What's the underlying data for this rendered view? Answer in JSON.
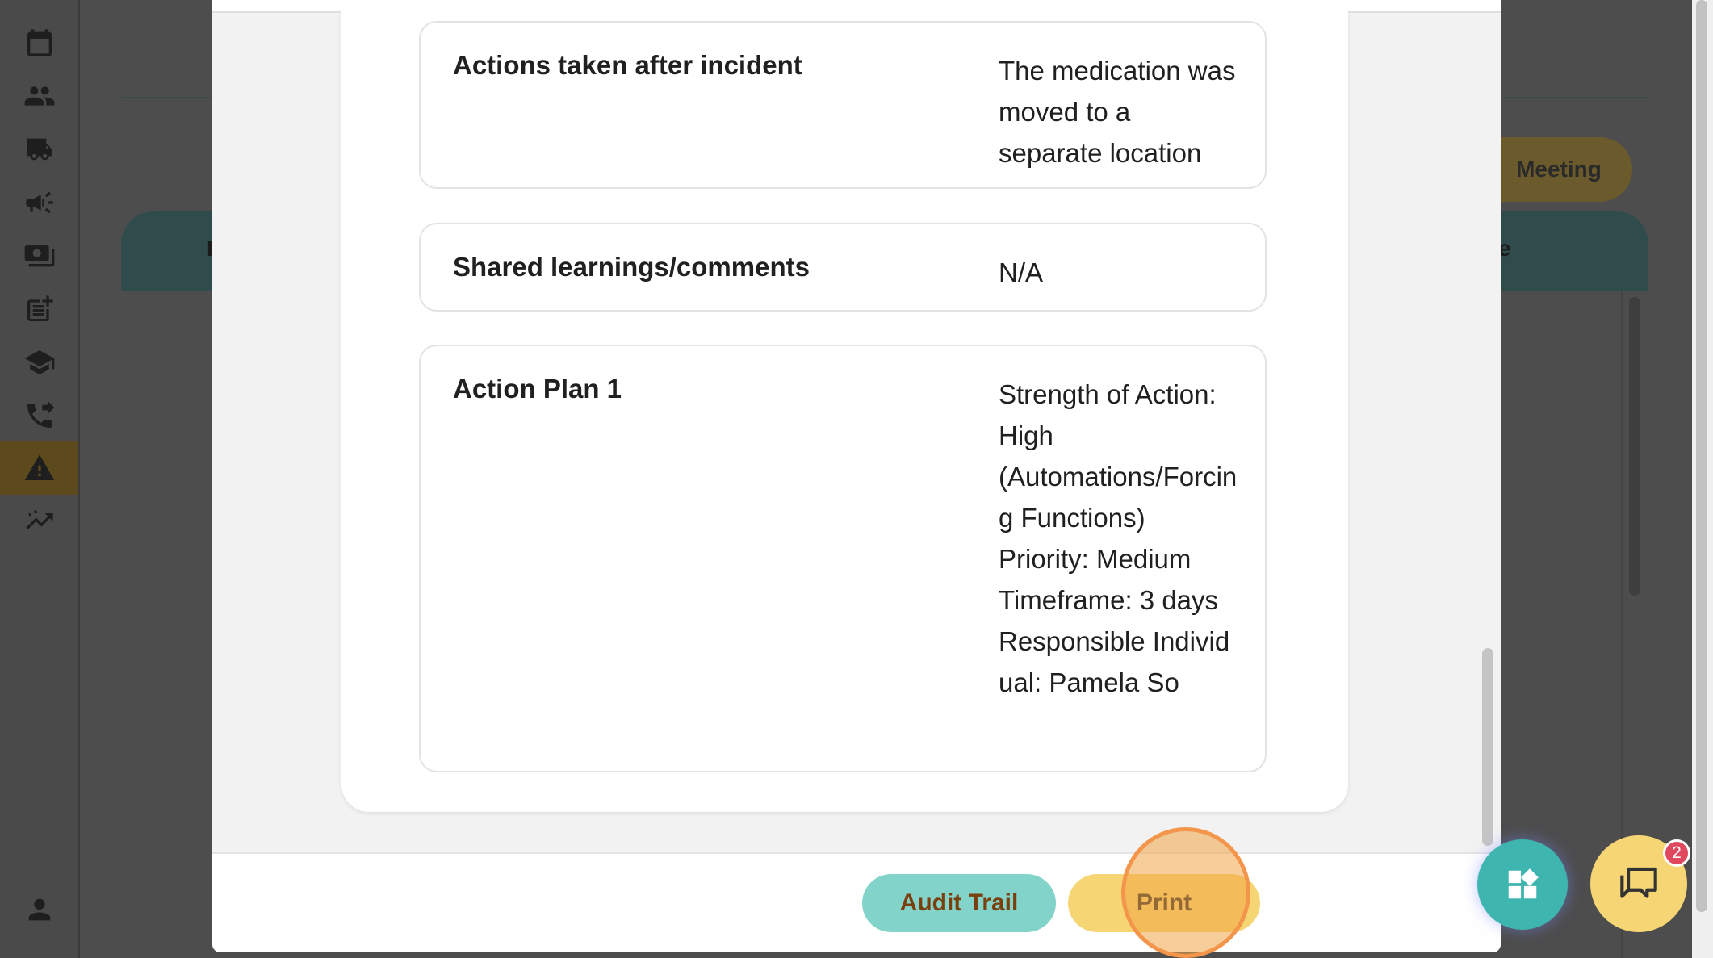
{
  "background": {
    "meeting_button_label": "Meeting",
    "band_left_fragment": "I",
    "band_right_fragment": "e"
  },
  "sidebar": {
    "items": [
      {
        "icon": "calendar-icon"
      },
      {
        "icon": "people-icon"
      },
      {
        "icon": "truck-icon"
      },
      {
        "icon": "megaphone-icon"
      },
      {
        "icon": "money-icon"
      },
      {
        "icon": "note-add-icon"
      },
      {
        "icon": "graduation-cap-icon"
      },
      {
        "icon": "phone-forward-icon"
      },
      {
        "icon": "warning-icon",
        "active": true
      },
      {
        "icon": "trending-icon"
      }
    ],
    "profile_icon": "person-icon"
  },
  "incident_details": [
    {
      "label": "Actions taken after incident",
      "value": "The medication was moved to a separate location"
    },
    {
      "label": "Shared learnings/comments",
      "value": "N/A"
    },
    {
      "label": "Action Plan 1",
      "value": "Strength of Action: High\n(Automations/Forcing Functions)\nPriority: Medium\nTimeframe: 3 days\nResponsible Individual: Pamela So"
    }
  ],
  "footer": {
    "audit_trail_label": "Audit Trail",
    "print_label": "Print"
  },
  "chat": {
    "badge_count": "2"
  },
  "colors": {
    "teal": "#82d4cb",
    "yellow": "#f6d674",
    "badge_red": "#e0485f",
    "highlight_orange": "#f3954a"
  }
}
